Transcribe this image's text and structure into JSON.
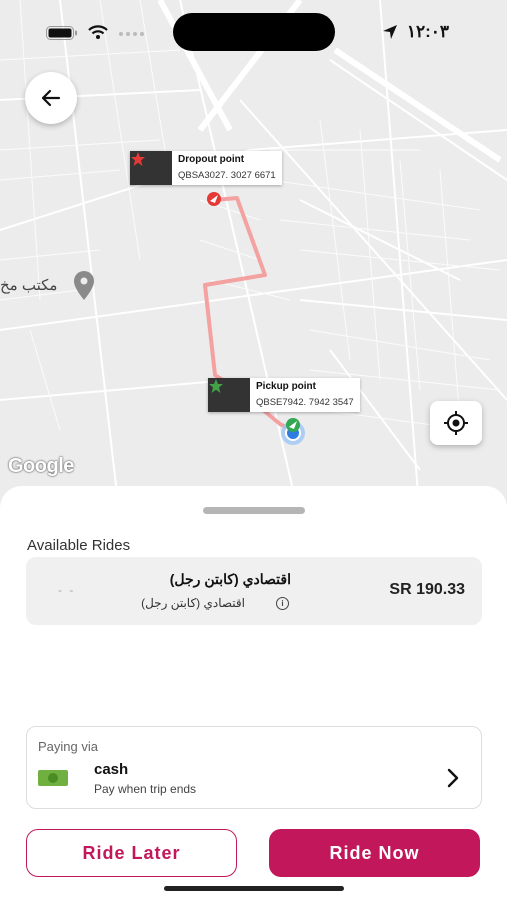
{
  "status_bar": {
    "time": "١٢:٠٣"
  },
  "map": {
    "dropoff": {
      "title": "Dropout point",
      "code": "QBSA3027. 3027 6671"
    },
    "pickup": {
      "title": "Pickup point",
      "code": "QBSE7942. 7942 3547"
    },
    "poi_label": "مكتب مخ",
    "attribution": "Google",
    "route_color": "#f4a1a1"
  },
  "rides": {
    "title": "Available Rides",
    "items": [
      {
        "name": "اقتصادي (كابتن رجل)",
        "subtitle": "اقتصادي (كابتن رجل)",
        "placeholder": "- -",
        "price": "SR 190.33"
      }
    ]
  },
  "payment": {
    "label": "Paying via",
    "method": "cash",
    "hint": "Pay when trip ends"
  },
  "actions": {
    "ride_later": "Ride Later",
    "ride_now": "Ride Now",
    "accent": "#c2185b"
  }
}
